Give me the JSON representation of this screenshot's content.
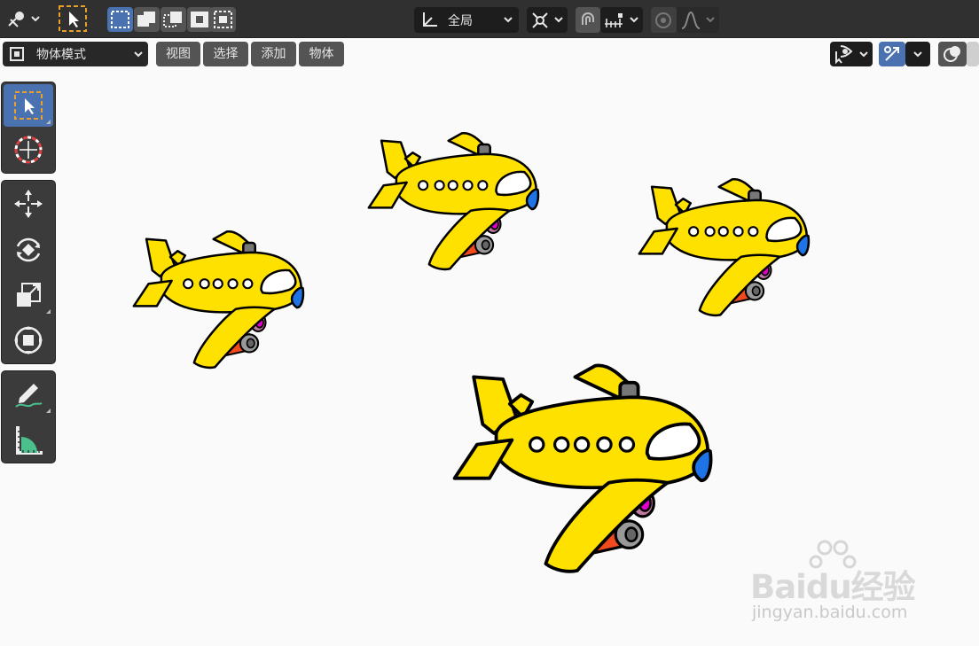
{
  "header": {
    "transform_orientation": "全局",
    "mode": "物体模式",
    "menus": [
      {
        "label": "视图"
      },
      {
        "label": "选择"
      },
      {
        "label": "添加"
      },
      {
        "label": "物体"
      }
    ]
  },
  "watermark": {
    "brand": "Baidu经验",
    "url": "jingyan.baidu.com"
  },
  "colors": {
    "accent": "#4b72b0",
    "plane_body": "#ffe100",
    "engine": "#f04a1e",
    "cockpit": "#1e73e6"
  }
}
